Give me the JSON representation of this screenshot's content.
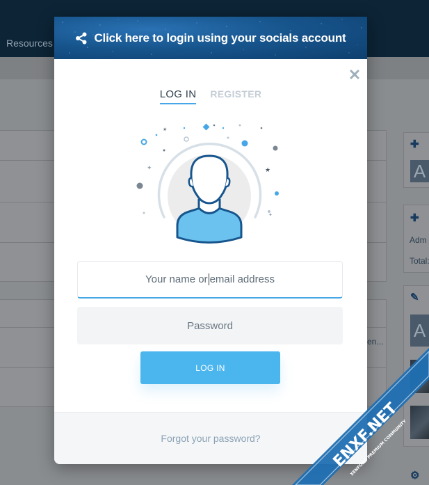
{
  "background": {
    "nav_link": "Resources",
    "avatar_letters": [
      "A",
      "A"
    ],
    "sidebar_texts": [
      "Adm",
      "Total:"
    ],
    "truncated_text": "en..."
  },
  "modal": {
    "social_login": {
      "label": "Click here to login using your socials account",
      "icon": "share-icon"
    },
    "close_icon": "close-icon",
    "tabs": [
      {
        "label": "LOG IN",
        "active": true
      },
      {
        "label": "REGISTER",
        "active": false
      }
    ],
    "illustration_icon": "user-avatar-icon",
    "username": {
      "placeholder_before": "Your name or",
      "placeholder_after": "email address",
      "value": ""
    },
    "password": {
      "placeholder": "Password",
      "value": ""
    },
    "login_button": "LOG IN",
    "forgot_link": "Forgot your password?"
  },
  "watermark": {
    "text": "ENXF.NET",
    "subtext": "XENFORO PREMIUM COMMUNITY"
  },
  "colors": {
    "accent": "#4bb5ee",
    "header_bg": "#0c2436",
    "social_bar": "#17558d"
  }
}
